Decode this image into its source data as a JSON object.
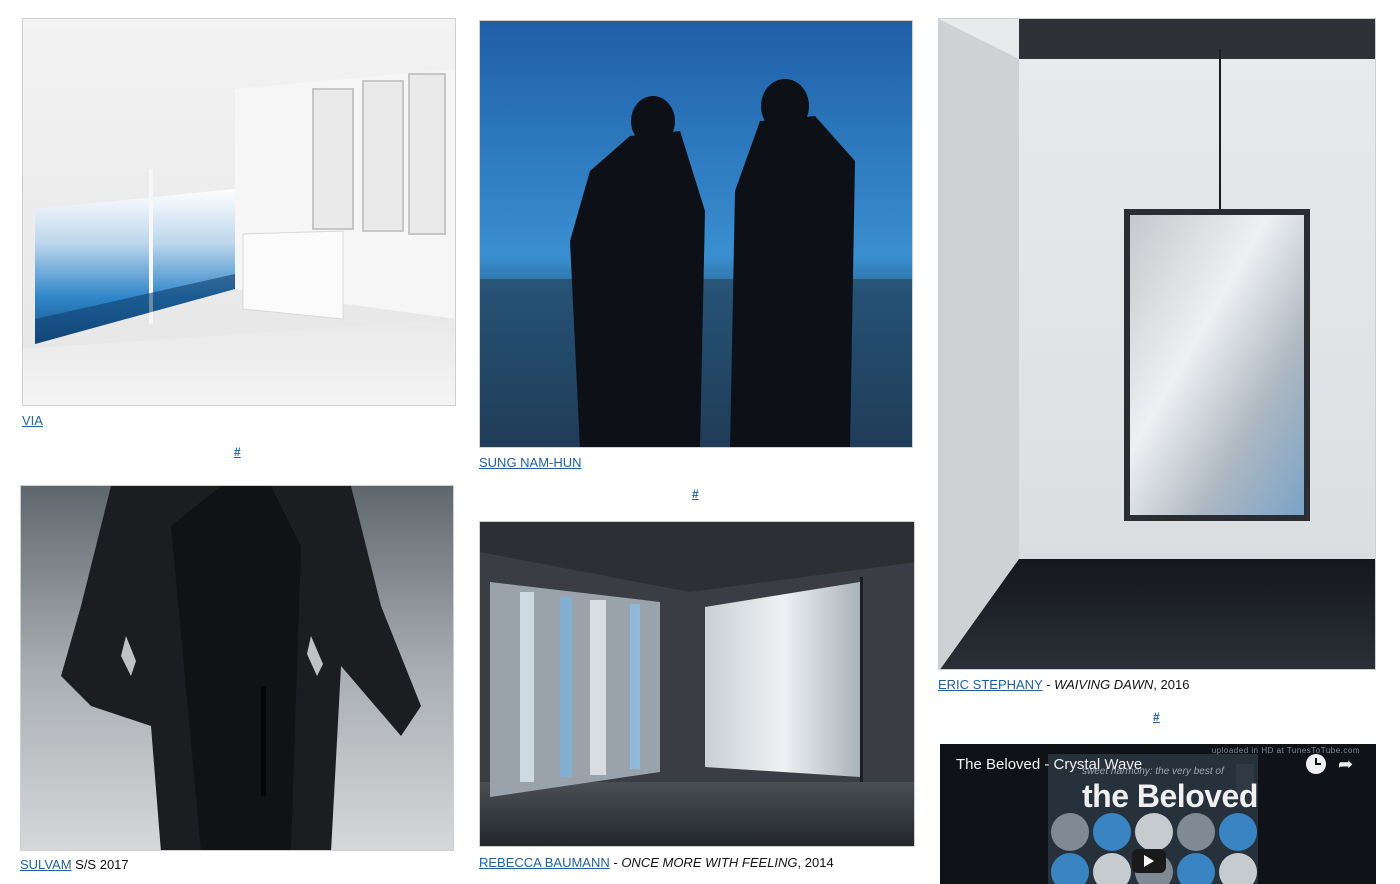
{
  "posts": [
    {
      "artist": "VIA",
      "rest": "",
      "title_italic": "",
      "suffix": "",
      "permalink": "#"
    },
    {
      "artist": "SULVAM",
      "rest": " S/S 2017",
      "title_italic": "",
      "suffix": ""
    },
    {
      "artist": "SUNG NAM-HUN",
      "rest": "",
      "title_italic": "",
      "suffix": "",
      "permalink": "#"
    },
    {
      "artist": "REBECCA BAUMANN",
      "rest": " - ",
      "title_italic": "ONCE MORE WITH FEELING",
      "suffix": ", 2014"
    },
    {
      "artist": "ERIC STEPHANY",
      "rest": " - ",
      "title_italic": "WAIVING DAWN",
      "suffix": ", 2016",
      "permalink": "#"
    }
  ],
  "video": {
    "title": "The Beloved - Crystal Wave",
    "uploaded_label": "uploaded in HD at TunesToTube.com",
    "album_subtitle": "sweet harmony: the very best of",
    "album_title": "the Beloved"
  },
  "icons": [
    "clock-icon",
    "share-icon",
    "play-icon"
  ],
  "colors": {
    "link": "#1f5f9a",
    "video_bg": "#0f1318"
  }
}
